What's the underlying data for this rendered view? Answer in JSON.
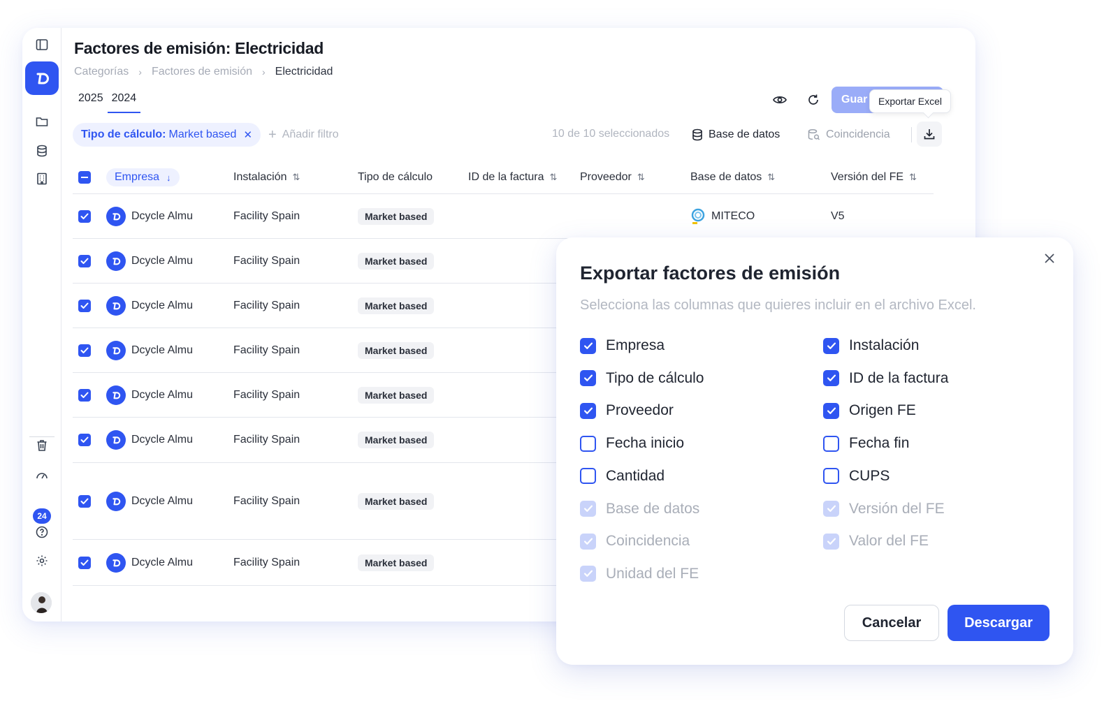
{
  "page": {
    "title": "Factores de emisión: Electricidad",
    "breadcrumb": [
      "Categorías",
      "Factores de emisión",
      "Electricidad"
    ],
    "years": [
      "2025",
      "2024"
    ],
    "active_year": "2024"
  },
  "toolbar": {
    "save_label": "Guar",
    "tooltip": "Exportar Excel",
    "filter_key": "Tipo de cálculo:",
    "filter_value": "Market based",
    "add_filter": "Añadir filtro",
    "selected_count": "10 de 10 seleccionados",
    "database_label": "Base de datos",
    "match_label": "Coincidencia"
  },
  "sidebar": {
    "badge": "24"
  },
  "table": {
    "columns": [
      "Empresa",
      "Instalación",
      "Tipo de cálculo",
      "ID de la factura",
      "Proveedor",
      "Base de datos",
      "Versión del FE"
    ],
    "rows": [
      {
        "empresa": "Dcycle Almu",
        "instalacion": "Facility Spain",
        "tipo": "Market based",
        "base": "MITECO",
        "version": "V5"
      },
      {
        "empresa": "Dcycle Almu",
        "instalacion": "Facility Spain",
        "tipo": "Market based",
        "base": "",
        "version": ""
      },
      {
        "empresa": "Dcycle Almu",
        "instalacion": "Facility Spain",
        "tipo": "Market based",
        "base": "",
        "version": ""
      },
      {
        "empresa": "Dcycle Almu",
        "instalacion": "Facility Spain",
        "tipo": "Market based",
        "base": "",
        "version": ""
      },
      {
        "empresa": "Dcycle Almu",
        "instalacion": "Facility Spain",
        "tipo": "Market based",
        "base": "",
        "version": ""
      },
      {
        "empresa": "Dcycle Almu",
        "instalacion": "Facility Spain",
        "tipo": "Market based",
        "base": "",
        "version": ""
      },
      {
        "empresa": "Dcycle Almu",
        "instalacion": "Facility Spain",
        "tipo": "Market based",
        "base": "",
        "version": ""
      },
      {
        "empresa": "Dcycle Almu",
        "instalacion": "Facility Spain",
        "tipo": "Market based",
        "base": "",
        "version": ""
      }
    ]
  },
  "modal": {
    "title": "Exportar factores de emisión",
    "subtitle": "Selecciona las columnas que quieres incluir en el archivo Excel.",
    "options": [
      {
        "label": "Empresa",
        "state": "checked"
      },
      {
        "label": "Instalación",
        "state": "checked"
      },
      {
        "label": "Tipo de cálculo",
        "state": "checked"
      },
      {
        "label": "ID de la factura",
        "state": "checked"
      },
      {
        "label": "Proveedor",
        "state": "checked"
      },
      {
        "label": "Origen FE",
        "state": "checked"
      },
      {
        "label": "Fecha inicio",
        "state": "unchecked"
      },
      {
        "label": "Fecha fin",
        "state": "unchecked"
      },
      {
        "label": "Cantidad",
        "state": "unchecked"
      },
      {
        "label": "CUPS",
        "state": "unchecked"
      },
      {
        "label": "Base de datos",
        "state": "disabled"
      },
      {
        "label": "Versión del FE",
        "state": "disabled"
      },
      {
        "label": "Coincidencia",
        "state": "disabled"
      },
      {
        "label": "Valor del FE",
        "state": "disabled"
      },
      {
        "label": "Unidad del FE",
        "state": "disabled"
      }
    ],
    "cancel_label": "Cancelar",
    "download_label": "Descargar"
  },
  "colors": {
    "accent": "#2f55f1",
    "accent_light": "#eef1ff",
    "disabled_check": "#c9d3fa"
  },
  "icons": [
    "sidebar-toggle-icon",
    "folder-icon",
    "database-icon",
    "building-icon",
    "trash-icon",
    "gauge-icon",
    "help-icon",
    "settings-icon",
    "eye-icon",
    "refresh-icon",
    "download-icon",
    "close-icon",
    "sort-icon",
    "arrow-down-icon",
    "plus-icon",
    "check-icon"
  ]
}
